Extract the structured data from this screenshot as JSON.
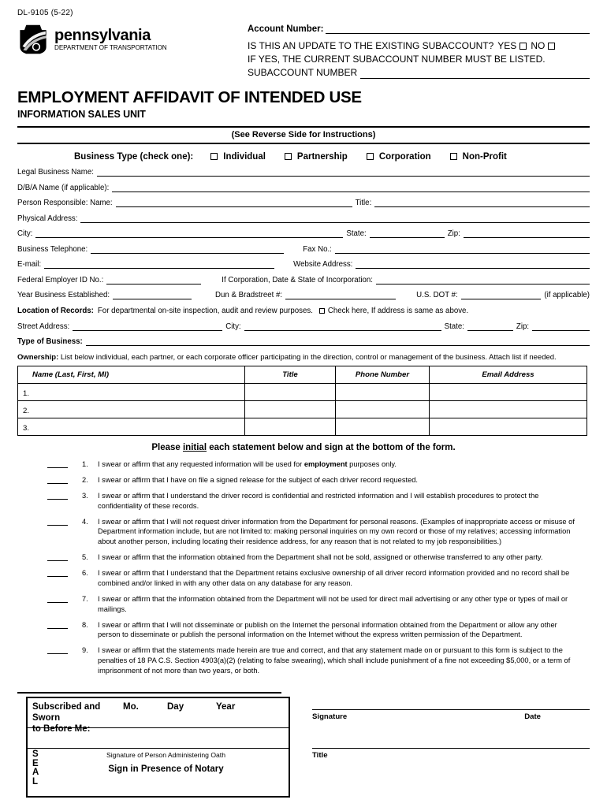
{
  "form_number": "DL-9105 (5-22)",
  "agency": {
    "name": "pennsylvania",
    "department": "DEPARTMENT OF TRANSPORTATION"
  },
  "header": {
    "account_number_label": "Account Number:",
    "update_question": "IS THIS AN UPDATE TO THE EXISTING SUBACCOUNT?",
    "yes_label": "YES",
    "no_label": "NO",
    "if_yes_line": "IF YES, THE CURRENT SUBACCOUNT NUMBER MUST BE LISTED.",
    "subaccount_label": "SUBACCOUNT NUMBER"
  },
  "title": "EMPLOYMENT AFFIDAVIT OF INTENDED USE",
  "subtitle": "INFORMATION SALES UNIT",
  "instructions_banner": "(See Reverse Side for Instructions)",
  "business_type": {
    "caption": "Business Type (check one):",
    "options": [
      "Individual",
      "Partnership",
      "Corporation",
      "Non-Profit"
    ]
  },
  "fields": {
    "legal_business_name": "Legal Business Name:",
    "dba_name": "D/B/A Name (if applicable):",
    "person_responsible": "Person Responsible:  Name:",
    "title": "Title:",
    "physical_address": "Physical Address:",
    "city": "City:",
    "state": "State:",
    "zip": "Zip:",
    "business_telephone": "Business Telephone:",
    "fax_no": "Fax No.:",
    "email": "E-mail:",
    "website_address": "Website Address:",
    "federal_employer_id": "Federal Employer ID No.:",
    "incorporation": "If Corporation, Date & State of Incorporation:",
    "year_established": "Year Business Established:",
    "dun_bradstreet": "Dun & Bradstreet #:",
    "us_dot": "U.S. DOT #:",
    "if_applicable": "(if applicable)",
    "street_address": "Street Address:",
    "type_of_business": "Type of Business:"
  },
  "location_of_records": {
    "label": "Location of Records:",
    "text": "For departmental on-site inspection, audit and review purposes.",
    "checkbox_text": "Check here, If address is same as above."
  },
  "ownership": {
    "label": "Ownership:",
    "text": "List below individual, each partner, or each corporate officer participating in the direction, control or management of the business. Attach list if needed.",
    "columns": [
      "Name (Last, First, MI)",
      "Title",
      "Phone Number",
      "Email Address"
    ],
    "rows": [
      "1.",
      "2.",
      "3."
    ]
  },
  "initial_heading": {
    "pre": "Please ",
    "emphasis": "initial",
    "post": " each statement below and sign at the bottom of the form."
  },
  "statements": [
    {
      "num": "1.",
      "pre": "I swear or affirm that any requested information will be used for ",
      "bold": "employment",
      "post": " purposes only."
    },
    {
      "num": "2.",
      "pre": "I swear or affirm that I have on file a signed release for the subject of each driver record requested.",
      "bold": "",
      "post": ""
    },
    {
      "num": "3.",
      "pre": "I swear or affirm that I understand the driver record is confidential and restricted information and I will establish procedures to protect the confidentiality of these records.",
      "bold": "",
      "post": ""
    },
    {
      "num": "4.",
      "pre": "I swear or affirm that I will not request driver information from the Department for personal reasons. (Examples of inappropriate access or misuse of Department information include, but are not limited to: making personal inquiries on my own record or those of my relatives; accessing information about another person, including locating their residence address, for any reason that is not related to my job responsibilities.)",
      "bold": "",
      "post": ""
    },
    {
      "num": "5.",
      "pre": "I swear or affirm that the information obtained from the Department shall not be sold, assigned or otherwise transferred to any other party.",
      "bold": "",
      "post": ""
    },
    {
      "num": "6.",
      "pre": "I swear or affirm that I understand that the Department retains exclusive ownership of all driver record information provided and no record shall be combined and/or linked in with any other data on any database for any reason.",
      "bold": "",
      "post": ""
    },
    {
      "num": "7.",
      "pre": "I swear or affirm that the information obtained from the Department will not be used for direct mail advertising or any other type or types of mail or mailings.",
      "bold": "",
      "post": ""
    },
    {
      "num": "8.",
      "pre": "I swear or affirm that I will not disseminate or publish on the Internet the personal information obtained from the Department or allow any other person to disseminate or publish the personal information on the Internet without the express written permission of the Department.",
      "bold": "",
      "post": ""
    },
    {
      "num": "9.",
      "pre": "I swear or affirm that the statements made herein are true and correct, and that any statement made on or pursuant to this form is subject to the penalties of 18 PA C.S. Section 4903(a)(2) (relating to false swearing), which shall include punishment of a fine not exceeding $5,000, or a term of imprisonment of not more than two years, or both.",
      "bold": "",
      "post": ""
    }
  ],
  "notary": {
    "subscribed_line1": "Subscribed and Sworn",
    "subscribed_line2": "to Before Me:",
    "mo": "Mo.",
    "day": "Day",
    "year": "Year",
    "seal": "SEAL",
    "oath_caption": "Signature of Person Administering Oath",
    "sign_presence": "Sign in Presence of Notary"
  },
  "signature_block": {
    "signature": "Signature",
    "date": "Date",
    "title": "Title"
  }
}
